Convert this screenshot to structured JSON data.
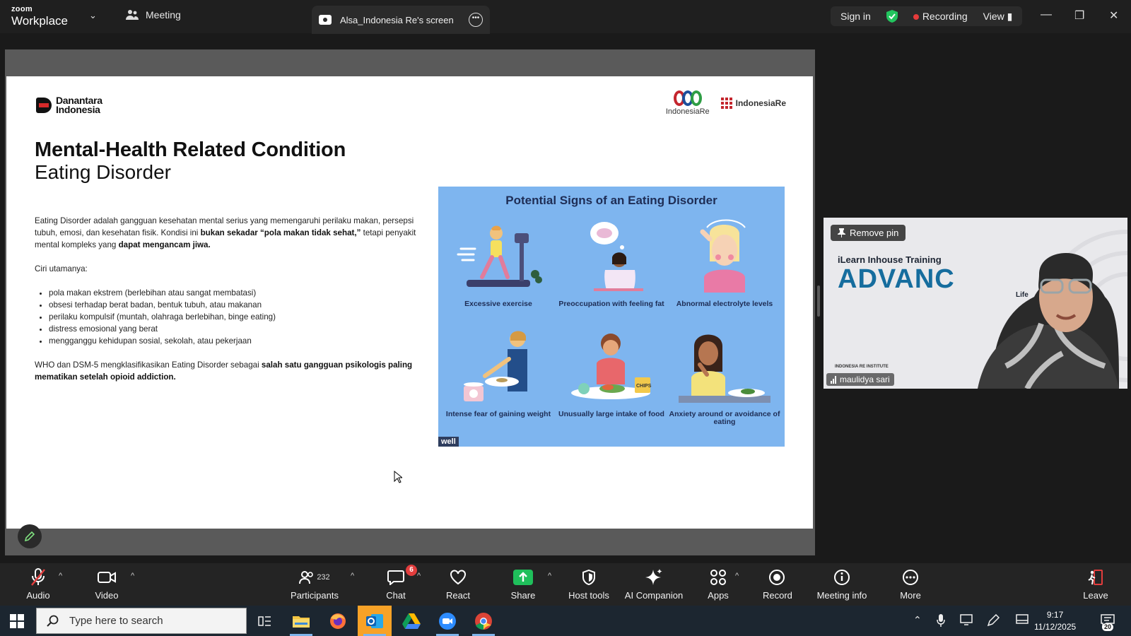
{
  "titlebar": {
    "brand_small": "zoom",
    "brand_big": "Workplace",
    "meeting_tab": "Meeting",
    "share_tab": "Alsa_Indonesia Re's screen",
    "sign_in": "Sign in",
    "recording": "Recording",
    "view": "View"
  },
  "slide": {
    "logo_left": "Danantara Indonesia",
    "logo_right_1": "IndonesiaRe",
    "logo_right_2": "IndonesiaRe",
    "title_bold": "Mental-Health Related Condition",
    "title_light": "Eating Disorder",
    "para1_a": "Eating Disorder adalah gangguan kesehatan mental serius yang memengaruhi perilaku makan, persepsi tubuh, emosi, dan kesehatan fisik. Kondisi ini ",
    "para1_b": "bukan sekadar “pola makan tidak sehat,”",
    "para1_c": " tetapi penyakit mental kompleks yang ",
    "para1_d": "dapat mengancam jiwa.",
    "ciri": "Ciri utamanya:",
    "bullets": [
      "pola makan ekstrem (berlebihan atau sangat membatasi)",
      "obsesi terhadap berat badan, bentuk tubuh, atau makanan",
      "perilaku kompulsif (muntah, olahraga berlebihan, binge eating)",
      "distress emosional yang berat",
      "mengganggu kehidupan sosial, sekolah, atau pekerjaan"
    ],
    "para2_a": "WHO dan DSM-5 mengklasifikasikan Eating Disorder sebagai ",
    "para2_b": "salah satu gangguan psikologis paling mematikan setelah opioid addiction.",
    "infographic": {
      "title": "Potential Signs of an Eating Disorder",
      "items": [
        "Excessive exercise",
        "Preoccupation with feeling fat",
        "Abnormal electrolyte levels",
        "Intense fear of gaining weight",
        "Unusually large intake of food",
        "Anxiety around or avoidance of eating"
      ],
      "tag": "well",
      "chips_label": "CHIPS"
    }
  },
  "video": {
    "remove_pin": "Remove pin",
    "name": "maulidya sari",
    "bg_head": "iLearn Inhouse Training",
    "bg_big": "ADVANC",
    "bg_sub": "Life",
    "bg_foot": "INDONESIA RE INSTITUTE"
  },
  "controls": {
    "audio": "Audio",
    "video": "Video",
    "participants": "Participants",
    "participants_count": "232",
    "chat": "Chat",
    "chat_badge": "6",
    "react": "React",
    "share": "Share",
    "host_tools": "Host tools",
    "ai_companion": "AI Companion",
    "apps": "Apps",
    "record": "Record",
    "meeting_info": "Meeting info",
    "more": "More",
    "leave": "Leave"
  },
  "taskbar": {
    "search_placeholder": "Type here to search",
    "time": "9:17",
    "date": "11/12/2025",
    "notif_count": "20"
  },
  "colors": {
    "bg": "#1a1a1a",
    "accent_green": "#22c55e",
    "recording_red": "#e63b3b",
    "infographic_blue": "#7eb5ef",
    "share_green": "#1fbf5b"
  }
}
